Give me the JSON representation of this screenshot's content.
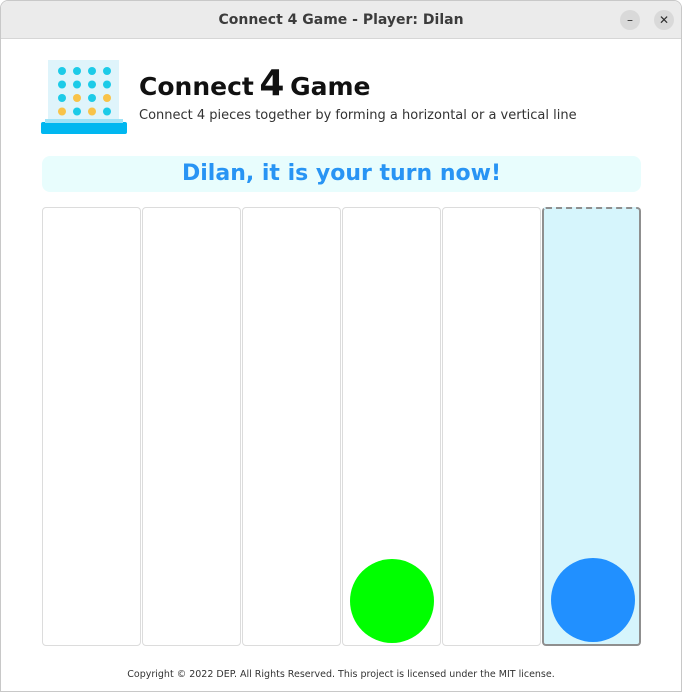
{
  "window": {
    "title": "Connect 4 Game - Player: Dilan",
    "minimize_symbol": "–",
    "close_symbol": "✕"
  },
  "header": {
    "logo_icon": "connect-four-board-icon",
    "title_word1": "Connect",
    "title_number": "4",
    "title_word2": "Game",
    "subtitle": "Connect 4 pieces together by forming a horizontal or a vertical line"
  },
  "status": {
    "turn_message": "Dilan, it is your turn now!"
  },
  "board": {
    "column_count": 6,
    "active_column": 6,
    "columns": [
      {
        "index": 1,
        "pieces": []
      },
      {
        "index": 2,
        "pieces": []
      },
      {
        "index": 3,
        "pieces": []
      },
      {
        "index": 4,
        "pieces": [
          "green"
        ]
      },
      {
        "index": 5,
        "pieces": []
      },
      {
        "index": 6,
        "pieces": [
          "blue"
        ]
      }
    ],
    "piece_colors": {
      "green": "#00ff00",
      "blue": "#2190ff"
    },
    "highlight_color": "#d6f5fc"
  },
  "footer": {
    "copyright": "Copyright © 2022 DEP. All Rights Reserved. This project is licensed under the MIT license."
  }
}
